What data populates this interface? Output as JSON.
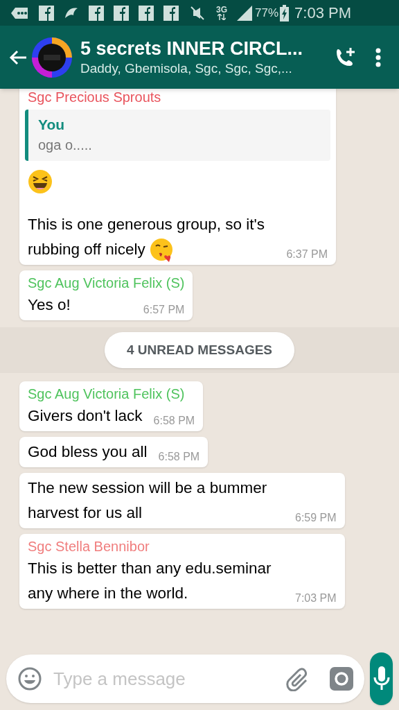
{
  "status_bar": {
    "network": "3G",
    "battery": "77%",
    "time": "7:03 PM"
  },
  "header": {
    "title": "5 secrets INNER CIRCL...",
    "subtitle": "Daddy, Gbemisola, Sgc, Sgc, Sgc,..."
  },
  "messages": [
    {
      "kind": "message",
      "sender": "Sgc Precious Sprouts",
      "color": "#e9545d",
      "quote": {
        "author": "You",
        "text": "oga o....."
      },
      "parts": [
        {
          "kind": "laughing-emoji"
        },
        {
          "kind": "blank"
        },
        {
          "kind": "text",
          "text": "This is one generous group, so it's"
        },
        {
          "kind": "text",
          "text": "rubbing off nicely"
        },
        {
          "kind": "kissing-emoji"
        }
      ],
      "time": "6:37 PM"
    },
    {
      "kind": "message",
      "sender": "Sgc Aug Victoria Felix (S)",
      "color": "#4fc35d",
      "parts": [
        {
          "kind": "text",
          "text": "Yes o!"
        }
      ],
      "time": "6:57 PM"
    },
    {
      "kind": "divider",
      "text": "4 UNREAD MESSAGES"
    },
    {
      "kind": "message",
      "sender": "Sgc Aug Victoria Felix (S)",
      "color": "#4fc35d",
      "parts": [
        {
          "kind": "text",
          "text": "Givers don't lack"
        }
      ],
      "time": "6:58 PM"
    },
    {
      "kind": "message",
      "parts": [
        {
          "kind": "text",
          "text": "God bless you all"
        }
      ],
      "time": "6:58 PM"
    },
    {
      "kind": "message",
      "parts": [
        {
          "kind": "text",
          "text": "The new session will be a bummer harvest for us all"
        }
      ],
      "time": "6:59 PM"
    },
    {
      "kind": "message",
      "sender": "Sgc Stella Bennibor",
      "color": "#f07d7d",
      "parts": [
        {
          "kind": "text",
          "text": "This is better than any edu.seminar any where in the world."
        }
      ],
      "time": "7:03 PM"
    }
  ],
  "composer": {
    "placeholder": "Type a message"
  }
}
